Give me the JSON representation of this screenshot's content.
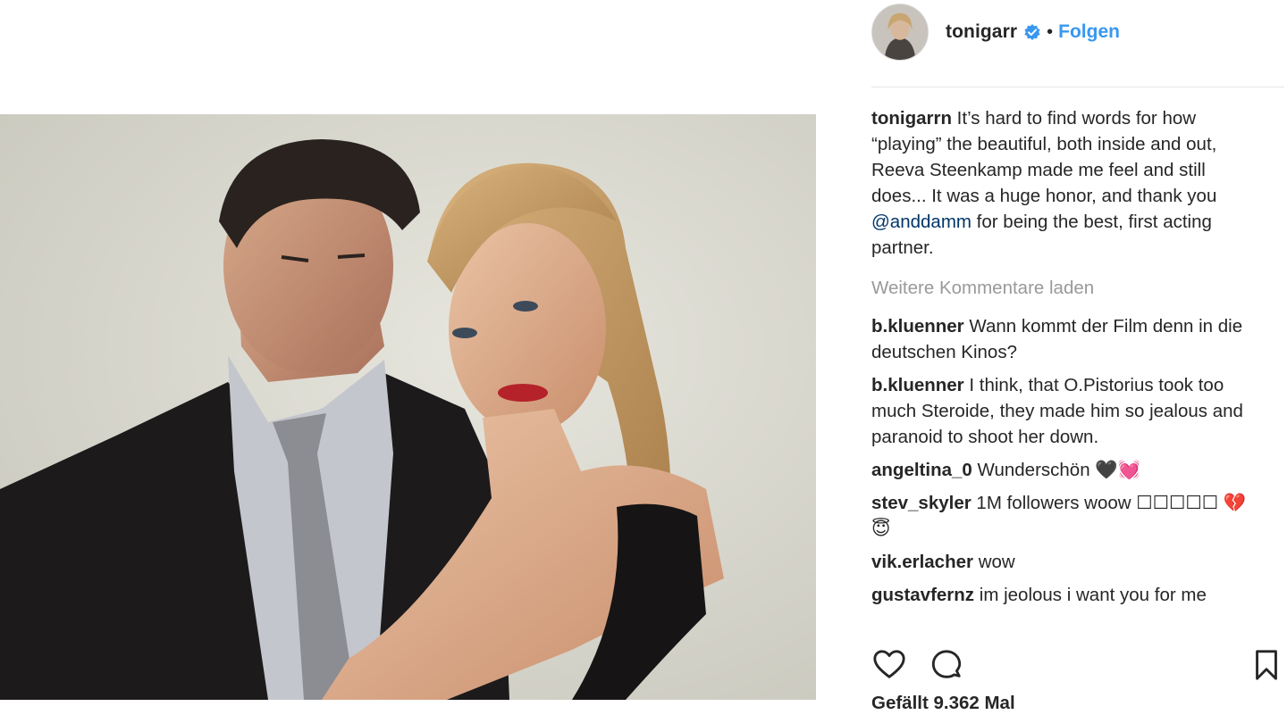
{
  "post": {
    "photo_alt": "photo"
  },
  "header": {
    "username": "tonigarr",
    "separator": "•",
    "follow_label": "Folgen"
  },
  "caption": {
    "username": "tonigarrn",
    "text_part1": "It’s hard to find words for how “playing” the beautiful, both inside and out, Reeva Steenkamp made me feel and still does... It was a huge honor, and thank you ",
    "mention": "@anddamm",
    "text_part2": " for being the best, first acting partner."
  },
  "load_more": "Weitere Kommentare laden",
  "comments": [
    {
      "username": "b.kluenner",
      "text": "Wann kommt der Film denn in die deutschen Kinos?"
    },
    {
      "username": "b.kluenner",
      "text": "I think, that O.Pistorius took too much Steroide, they made him so jealous and paranoid to shoot her down."
    },
    {
      "username": "angeltina_0",
      "text": "Wunderschön 🖤💓"
    },
    {
      "username": "stev_skyler",
      "text": "1M followers woow ☐☐☐☐☐ 💔😇"
    },
    {
      "username": "vik.erlacher",
      "text": "wow"
    },
    {
      "username": "gustavfernz",
      "text": "im jeolous i want you for me"
    }
  ],
  "actions": {
    "like_icon": "heart-icon",
    "comment_icon": "comment-icon",
    "save_icon": "bookmark-icon"
  },
  "likes_text": "Gefällt 9.362 Mal",
  "colors": {
    "link_blue": "#3897f0",
    "mention_blue": "#003569",
    "muted_gray": "#999999",
    "text": "#262626"
  }
}
